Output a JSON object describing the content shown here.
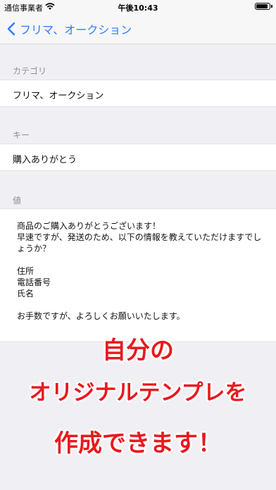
{
  "status_bar": {
    "carrier": "通信事業者",
    "time": "午後10:43",
    "battery_level": 0.9
  },
  "nav": {
    "back_label": "フリマ、オークション"
  },
  "sections": {
    "category": {
      "header": "カテゴリ",
      "value": "フリマ、オークション"
    },
    "key": {
      "header": "キー",
      "value": "購入ありがとう"
    },
    "value": {
      "header": "値",
      "text": "商品のご購入ありがとうございます！\n早速ですが、発送のため、以下の情報を教えていただけますでしょうか？\n\n住所\n電話番号\n氏名\n\nお手数ですが、よろしくお願いいたします。"
    }
  },
  "promo": {
    "line1": "自分の",
    "line2": "オリジナルテンプレを",
    "line3": "作成できます！"
  },
  "colors": {
    "accent": "#2f7cf6",
    "promo_red": "#e8191f",
    "background": "#efeff4"
  }
}
